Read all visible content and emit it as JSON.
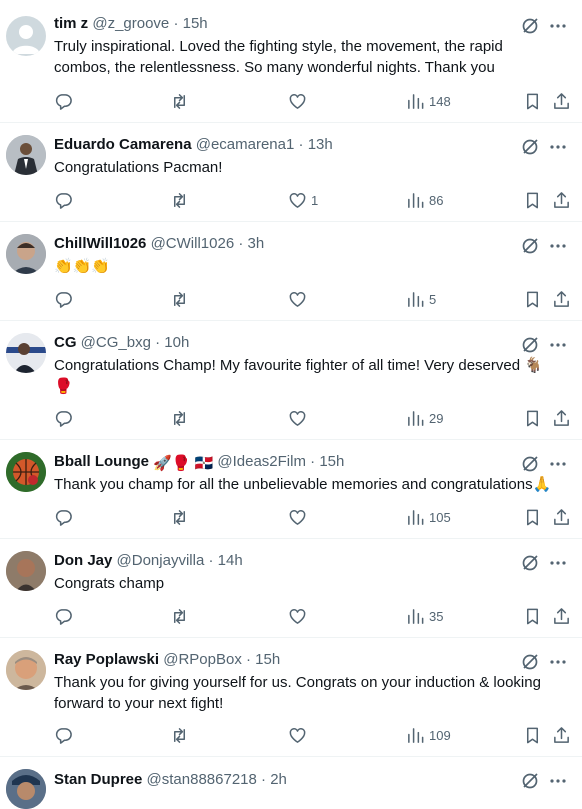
{
  "tweets": [
    {
      "name": "tim z",
      "handle": "@z_groove",
      "time": "15h",
      "text": [
        "Truly inspirational. Loved the fighting style, the movement, the rapid",
        "combos, the relentlessness. So many wonderful nights. Thank you"
      ],
      "replies": "",
      "reposts": "",
      "likes": "",
      "views": "148"
    },
    {
      "name": "Eduardo Camarena",
      "handle": "@ecamarena1",
      "time": "13h",
      "text": [
        "Congratulations Pacman!"
      ],
      "replies": "",
      "reposts": "",
      "likes": "1",
      "views": "86"
    },
    {
      "name": "ChillWill1026",
      "handle": "@CWill1026",
      "time": "3h",
      "text": [
        "👏👏👏"
      ],
      "replies": "",
      "reposts": "",
      "likes": "",
      "views": "5"
    },
    {
      "name": "CG",
      "handle": "@CG_bxg",
      "time": "10h",
      "text": [
        "Congratulations Champ! My favourite fighter of all time! Very deserved 🐐",
        "🥊"
      ],
      "replies": "",
      "reposts": "",
      "likes": "",
      "views": "29"
    },
    {
      "name": "Bball Lounge",
      "name_emojis": "🚀🥊 🇩🇴",
      "handle": "@Ideas2Film",
      "time": "15h",
      "text": [
        "Thank you champ for all the unbelievable memories and congratulations🙏"
      ],
      "replies": "",
      "reposts": "",
      "likes": "",
      "views": "105"
    },
    {
      "name": "Don Jay",
      "handle": "@Donjayvilla",
      "time": "14h",
      "text": [
        "Congrats champ"
      ],
      "replies": "",
      "reposts": "",
      "likes": "",
      "views": "35"
    },
    {
      "name": "Ray Poplawski",
      "handle": "@RPopBox",
      "time": "15h",
      "text": [
        "Thank you for giving yourself for us. Congrats on your induction & looking",
        "forward to your next fight!"
      ],
      "replies": "",
      "reposts": "",
      "likes": "",
      "views": "109"
    },
    {
      "name": "Stan Dupree",
      "handle": "@stan88867218",
      "time": "2h",
      "text": [],
      "replies": "",
      "reposts": "",
      "likes": "",
      "views": ""
    }
  ],
  "colors": {
    "text": "#0f1419",
    "secondary": "#536471",
    "divider": "#eff3f4"
  },
  "icons": {
    "reply": "reply-icon",
    "repost": "repost-icon",
    "like": "heart-icon",
    "views": "views-icon",
    "bookmark": "bookmark-icon",
    "share": "share-icon",
    "grok": "grok-icon",
    "more": "more-icon"
  }
}
